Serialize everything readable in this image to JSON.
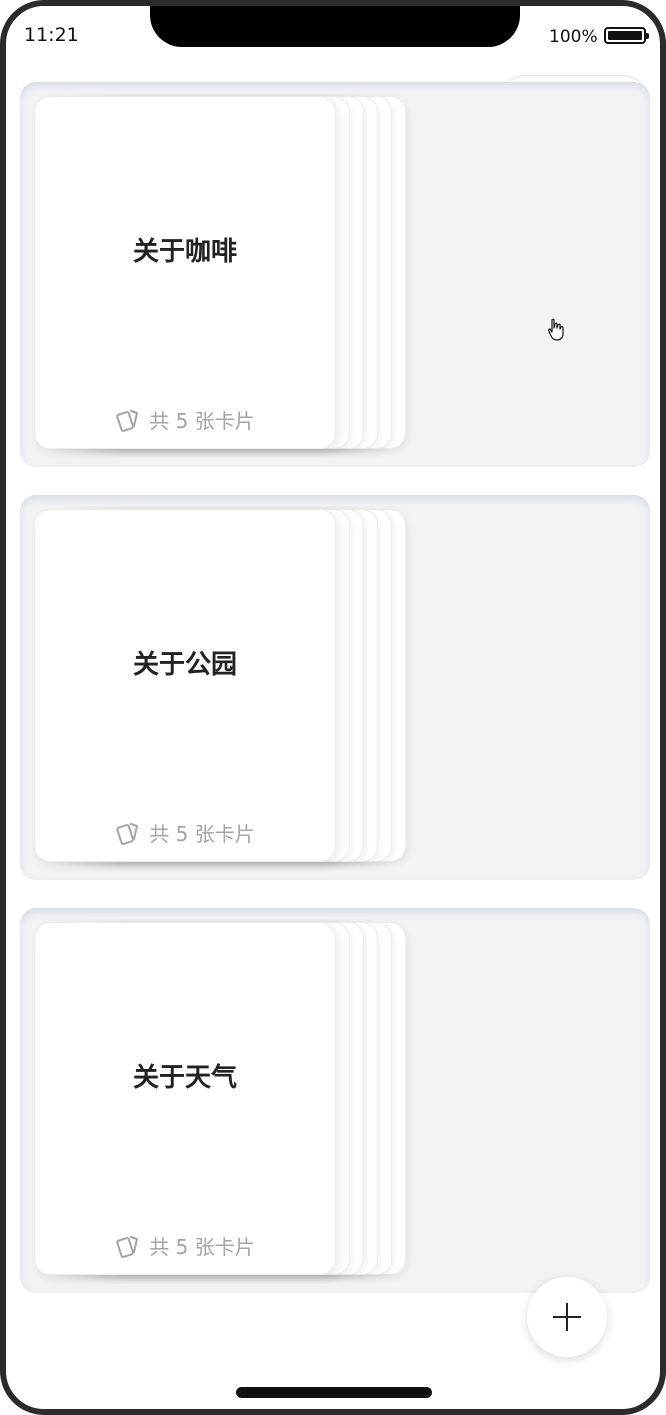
{
  "status_bar": {
    "time": "11:21",
    "battery_percent": "100%",
    "battery_level": 1.0
  },
  "capsule": {
    "menu_icon": "more-dots-icon",
    "close_icon": "target-circle-icon"
  },
  "decks": [
    {
      "title": "关于咖啡",
      "count_label": "共 5 张卡片",
      "card_count": 5
    },
    {
      "title": "关于公园",
      "count_label": "共 5 张卡片",
      "card_count": 5
    },
    {
      "title": "关于天气",
      "count_label": "共 5 张卡片",
      "card_count": 5
    }
  ],
  "fab": {
    "icon": "plus-icon"
  },
  "colors": {
    "panel_bg": "#f2f3f5",
    "card_bg": "#ffffff",
    "title_text": "#222222",
    "count_text": "#a0a4ab"
  }
}
